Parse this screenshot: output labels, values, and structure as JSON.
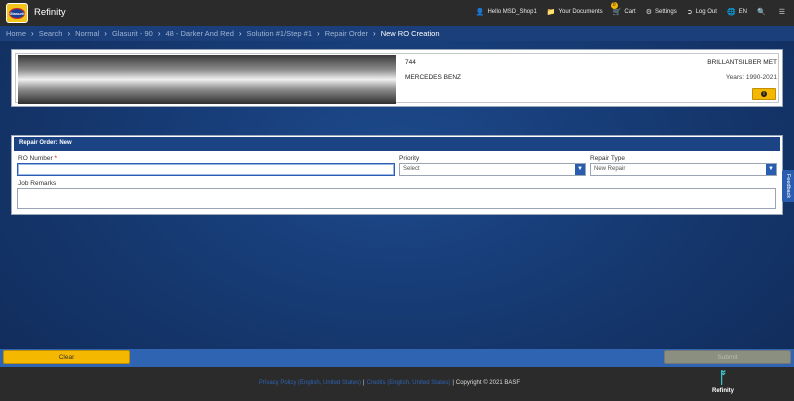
{
  "app": {
    "title": "Refinity",
    "logo_text": "Glasurit"
  },
  "topnav": {
    "user": "Hello MSD_Shop1",
    "documents": "Your Documents",
    "cart": "Cart",
    "cart_count": "0",
    "settings": "Settings",
    "logout": "Log Out",
    "language": "EN"
  },
  "breadcrumb": [
    "Home",
    "Search",
    "Normal",
    "Glasurit - 90",
    "48 - Darker And Red",
    "Solution #1/Step #1",
    "Repair Order",
    "New RO Creation"
  ],
  "vehicle": {
    "code": "744",
    "make": "MERCEDES BENZ",
    "color_name": "BRILLANTSILBER MET",
    "years": "Years: 1990-2021"
  },
  "repair_order": {
    "header": "Repair Order: New",
    "ro_number_label": "RO Number",
    "ro_number_required": "*",
    "ro_number_value": "",
    "priority_label": "Priority",
    "priority_value": "Select",
    "repair_type_label": "Repair Type",
    "repair_type_value": "New Repair",
    "job_remarks_label": "Job Remarks",
    "job_remarks_value": ""
  },
  "feedback_label": "Feedback",
  "actions": {
    "clear": "Clear",
    "submit": "Submit"
  },
  "footer": {
    "privacy": "Privacy Policy (English, United States)",
    "credits": "Credits (English, United States)",
    "copyright": "Copyright © 2021 BASF",
    "brand": "Refinity"
  },
  "colors": {
    "accent": "#f5b800",
    "nav_blue": "#1a3f7a",
    "header_dark": "#2b2b2b"
  }
}
